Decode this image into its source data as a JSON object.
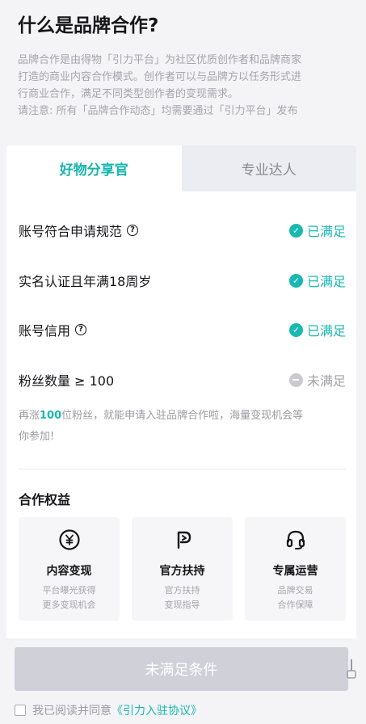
{
  "page": {
    "title": "什么是品牌合作?",
    "intro_line1": "品牌合作是由得物「引力平台」为社区优质创作者和品牌商家",
    "intro_line2": "打造的商业内容合作模式。创作者可以与品牌方以任务形式进",
    "intro_line3": "行商业合作，满足不同类型创作者的变现需求。",
    "intro_line4": "请注意: 所有「品牌合作动态」均需要通过「引力平台」发布"
  },
  "tabs": [
    {
      "label": "好物分享官",
      "active": true
    },
    {
      "label": "专业达人",
      "active": false
    }
  ],
  "requirements": [
    {
      "label": "账号符合申请规范",
      "has_help": true,
      "status": "已满足",
      "met": true
    },
    {
      "label": "实名认证且年满18周岁",
      "has_help": false,
      "status": "已满足",
      "met": true
    },
    {
      "label": "账号信用",
      "has_help": true,
      "status": "已满足",
      "met": true
    },
    {
      "label": "粉丝数量 ≥ 100",
      "has_help": false,
      "status": "未满足",
      "met": false
    }
  ],
  "hint": {
    "prefix": "再涨",
    "count": "100",
    "suffix_line1": "位粉丝，就能申请入驻品牌合作啦，海量变现机会等",
    "line2": "你参加!"
  },
  "benefits": {
    "title": "合作权益",
    "items": [
      {
        "name": "内容变现",
        "desc1": "平台曝光获得",
        "desc2": "更多变现机会",
        "icon": "yen-coin-icon"
      },
      {
        "name": "官方扶持",
        "desc1": "官方扶持",
        "desc2": "变现指导",
        "icon": "p-logo-icon"
      },
      {
        "name": "专属运营",
        "desc1": "品牌交易",
        "desc2": "合作保障",
        "icon": "headset-icon"
      }
    ]
  },
  "footer": {
    "button_label": "未满足条件",
    "agree_prefix": "我已阅读并同意",
    "agree_link": "《引力入驻协议》"
  },
  "colors": {
    "accent": "#17b9b0",
    "muted": "#a4a4ac",
    "button_disabled": "#cfd0d8"
  }
}
